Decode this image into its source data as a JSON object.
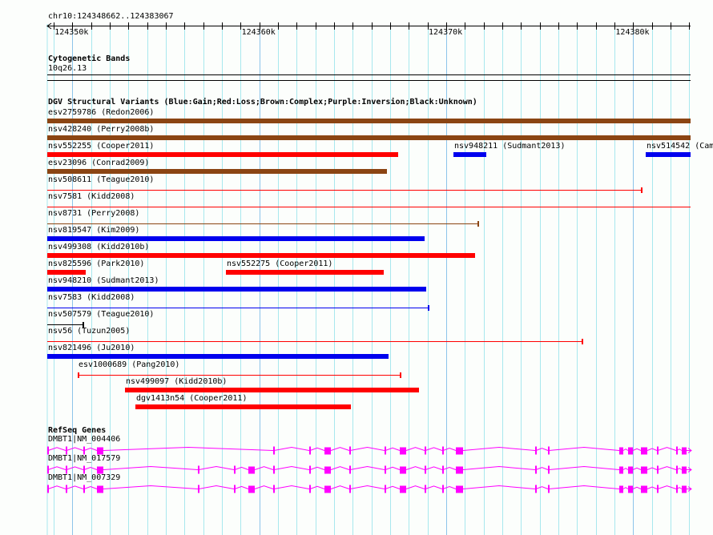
{
  "view": {
    "location": "chr10:124348662..124383067",
    "start": 124348662,
    "end": 124383067
  },
  "ruler": {
    "labels": [
      {
        "text": "124350k",
        "pos": 124350000
      },
      {
        "text": "124360k",
        "pos": 124360000
      },
      {
        "text": "124370k",
        "pos": 124370000
      },
      {
        "text": "124380k",
        "pos": 124380000
      }
    ]
  },
  "cytobands": {
    "title": "Cytogenetic Bands",
    "band": "10q26.13"
  },
  "dgv": {
    "title": "DGV Structural Variants (Blue:Gain;Red:Loss;Brown:Complex;Purple:Inversion;Black:Unknown)",
    "colors": {
      "gain": "#0000ee",
      "loss": "#ff0000",
      "complex": "#8b4513",
      "unknown": "#000000"
    },
    "variants": [
      {
        "label": "esv2759786 (Redon2006)",
        "row": 0,
        "start": 124348662,
        "end": 124383067,
        "type": "complex",
        "style": "bar"
      },
      {
        "label": "nsv428240 (Perry2008b)",
        "row": 1,
        "start": 124348662,
        "end": 124383067,
        "type": "complex",
        "style": "bar"
      },
      {
        "label": "nsv552255 (Cooper2011)",
        "row": 2,
        "start": 124348662,
        "end": 124367428,
        "type": "loss",
        "style": "bar"
      },
      {
        "label": "nsv948211 (Sudmant2013)",
        "row": 2,
        "start": 124370385,
        "end": 124372142,
        "type": "gain",
        "style": "bar"
      },
      {
        "label": "nsv514542 (Cam",
        "row": 2,
        "start": 124380668,
        "end": 124383067,
        "type": "gain",
        "style": "bar"
      },
      {
        "label": "esv23096 (Conrad2009)",
        "row": 3,
        "start": 124348662,
        "end": 124366829,
        "type": "complex",
        "style": "bar"
      },
      {
        "label": "nsv508611 (Teague2010)",
        "row": 4,
        "start": 124348662,
        "end": 124380454,
        "type": "loss",
        "style": "line"
      },
      {
        "label": "nsv7581 (Kidd2008)",
        "row": 5,
        "start": 124348662,
        "end": 124383067,
        "type": "loss",
        "style": "line"
      },
      {
        "label": "nsv8731 (Perry2008)",
        "row": 6,
        "start": 124348662,
        "end": 124371713,
        "type": "complex",
        "style": "line"
      },
      {
        "label": "nsv819547 (Kim2009)",
        "row": 7,
        "start": 124348662,
        "end": 124368842,
        "type": "gain",
        "style": "bar"
      },
      {
        "label": "nsv499308 (Kidd2010b)",
        "row": 8,
        "start": 124348662,
        "end": 124371542,
        "type": "loss",
        "style": "bar"
      },
      {
        "label": "nsv825596 (Park2010)",
        "row": 9,
        "start": 124348662,
        "end": 124350719,
        "type": "loss",
        "style": "bar"
      },
      {
        "label": "nsv552275 (Cooper2011)",
        "row": 9,
        "start": 124358217,
        "end": 124366657,
        "type": "loss",
        "style": "bar"
      },
      {
        "label": "nsv948210 (Sudmant2013)",
        "row": 10,
        "start": 124348662,
        "end": 124368928,
        "type": "gain",
        "style": "bar"
      },
      {
        "label": "nsv7583 (Kidd2008)",
        "row": 11,
        "start": 124348662,
        "end": 124369056,
        "type": "gain",
        "style": "line"
      },
      {
        "label": "nsv507579 (Teague2010)",
        "row": 12,
        "start": 124348662,
        "end": 124350590,
        "type": "unknown",
        "style": "line"
      },
      {
        "label": "nsv56 (Tuzun2005)",
        "row": 13,
        "start": 124348662,
        "end": 124377283,
        "type": "loss",
        "style": "line"
      },
      {
        "label": "nsv821496 (Ju2010)",
        "row": 14,
        "start": 124348662,
        "end": 124366914,
        "type": "gain",
        "style": "bar"
      },
      {
        "label": "esv1000689 (Pang2010)",
        "row": 15,
        "start": 124350290,
        "end": 124367557,
        "type": "loss",
        "style": "line"
      },
      {
        "label": "nsv499097 (Kidd2010b)",
        "row": 16,
        "start": 124352818,
        "end": 124368543,
        "type": "loss",
        "style": "bar"
      },
      {
        "label": "dgv1413n54 (Cooper2011)",
        "row": 17,
        "start": 124353375,
        "end": 124364901,
        "type": "loss",
        "style": "bar"
      }
    ]
  },
  "refseq": {
    "title": "RefSeq Genes",
    "color": "#ff00ff",
    "genes": [
      {
        "label": "DMBT1|NM_004406",
        "variant": "short"
      },
      {
        "label": "DMBT1|NM_017579",
        "variant": "long"
      },
      {
        "label": "DMBT1|NM_007329",
        "variant": "long"
      }
    ]
  }
}
